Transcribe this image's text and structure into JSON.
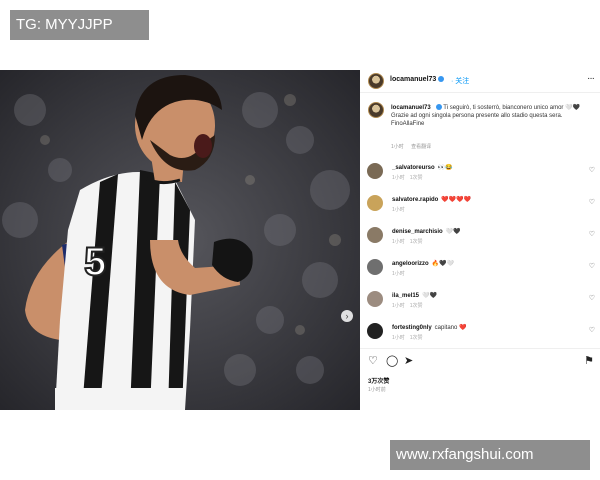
{
  "watermarks": {
    "top": "TG: MYYJJPP",
    "bottom": "www.rxfangshui.com"
  },
  "post": {
    "username": "locamanuel73",
    "follow_label": "关注",
    "more_icon": "more-horizontal-icon",
    "carousel_icon": "chevron-right-icon",
    "caption": {
      "username": "locamanuel73",
      "text": "Ti seguirò, ti sosterrò, bianconero unico amor 🤍🖤",
      "text2": "Grazie ad ogni singola persona presente allo stadio questa sera. FinoAllaFine",
      "time": "1小时",
      "translate_label": "查看翻译"
    },
    "comments": [
      {
        "user": "_salvatoreurso",
        "text": "👀😂",
        "meta": [
          "1小时",
          "1次赞"
        ],
        "avatar_color": "#7a6a55"
      },
      {
        "user": "salvatore.rapido",
        "text": "❤️❤️❤️❤️",
        "meta": [
          "1小时"
        ],
        "avatar_color": "#c9a35a"
      },
      {
        "user": "denise_marchisio",
        "text": "🤍🖤",
        "meta": [
          "1小时",
          "1次赞"
        ],
        "avatar_color": "#8a7a66"
      },
      {
        "user": "angeloorizzo",
        "text": "🔥🖤🤍",
        "meta": [
          "1小时"
        ],
        "avatar_color": "#6f6f6f"
      },
      {
        "user": "ila_mel15",
        "text": "🤍🖤",
        "meta": [
          "1小时",
          "1次赞"
        ],
        "avatar_color": "#9c8c80"
      },
      {
        "user": "fortesting0nly",
        "text": "capitano ❤️",
        "meta": [
          "1小时",
          "1次赞"
        ],
        "avatar_color": "#222222"
      }
    ],
    "actions": {
      "like_icon": "heart-icon",
      "comment_icon": "comment-icon",
      "share_icon": "send-icon",
      "save_icon": "bookmark-icon"
    },
    "likes": "3万次赞",
    "date": "1小时前"
  },
  "colors": {
    "link_blue": "#0095f6",
    "verified_blue": "#3797f0",
    "watermark_bg": "#8e8e8e"
  }
}
